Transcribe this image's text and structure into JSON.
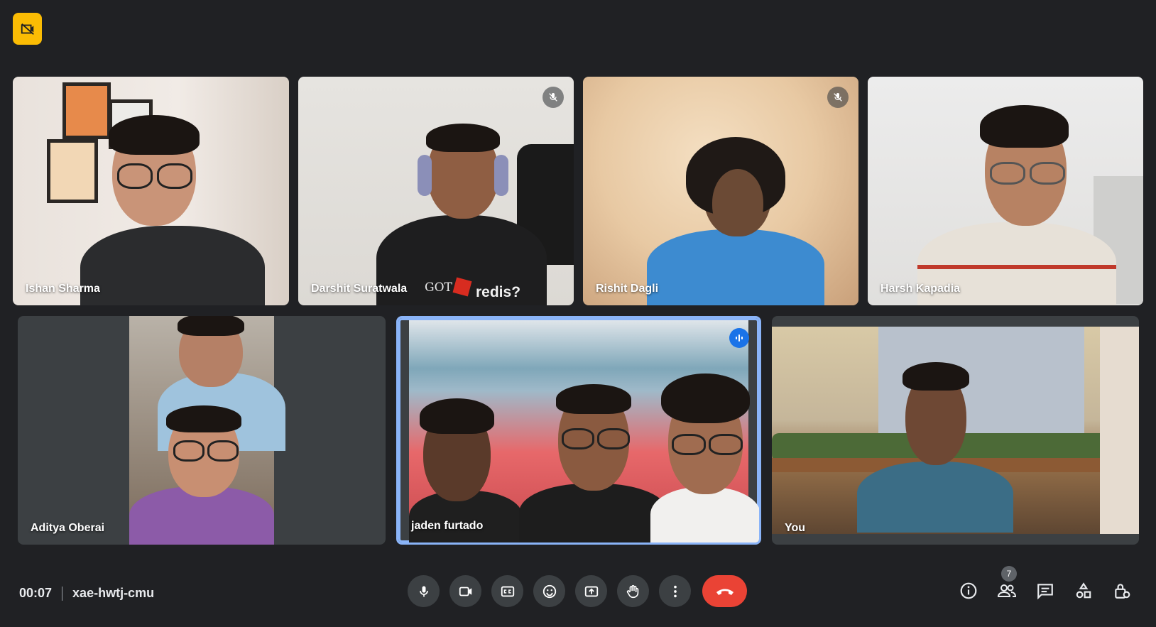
{
  "meeting": {
    "time": "00:07",
    "code": "xae-hwtj-cmu",
    "participant_count": "7"
  },
  "participants": [
    {
      "name": "Ishan Sharma",
      "muted": false
    },
    {
      "name": "Darshit Suratwala",
      "muted": true
    },
    {
      "name": "Rishit Dagli",
      "muted": true
    },
    {
      "name": "Harsh Kapadia",
      "muted": false
    },
    {
      "name": "Aditya Oberai",
      "muted": false
    },
    {
      "name": "jaden furtado",
      "muted": false,
      "speaking": true
    },
    {
      "name": "You",
      "muted": false
    }
  ],
  "shirt_text": {
    "got": "GOT",
    "redis": "redis?"
  },
  "colors": {
    "background": "#202124",
    "tile": "#3c4043",
    "accent": "#1a73e8",
    "end_call": "#ea4335",
    "record_badge": "#fbbc04"
  },
  "icons": {
    "recording": "recording-badge-icon",
    "mic": "mic-icon",
    "camera": "camera-icon",
    "captions": "captions-icon",
    "emoji": "emoji-icon",
    "present": "present-screen-icon",
    "hand": "raise-hand-icon",
    "more": "more-options-icon",
    "end": "end-call-icon",
    "info": "info-icon",
    "people": "people-icon",
    "chat": "chat-icon",
    "activities": "activities-icon",
    "host": "host-controls-icon"
  }
}
